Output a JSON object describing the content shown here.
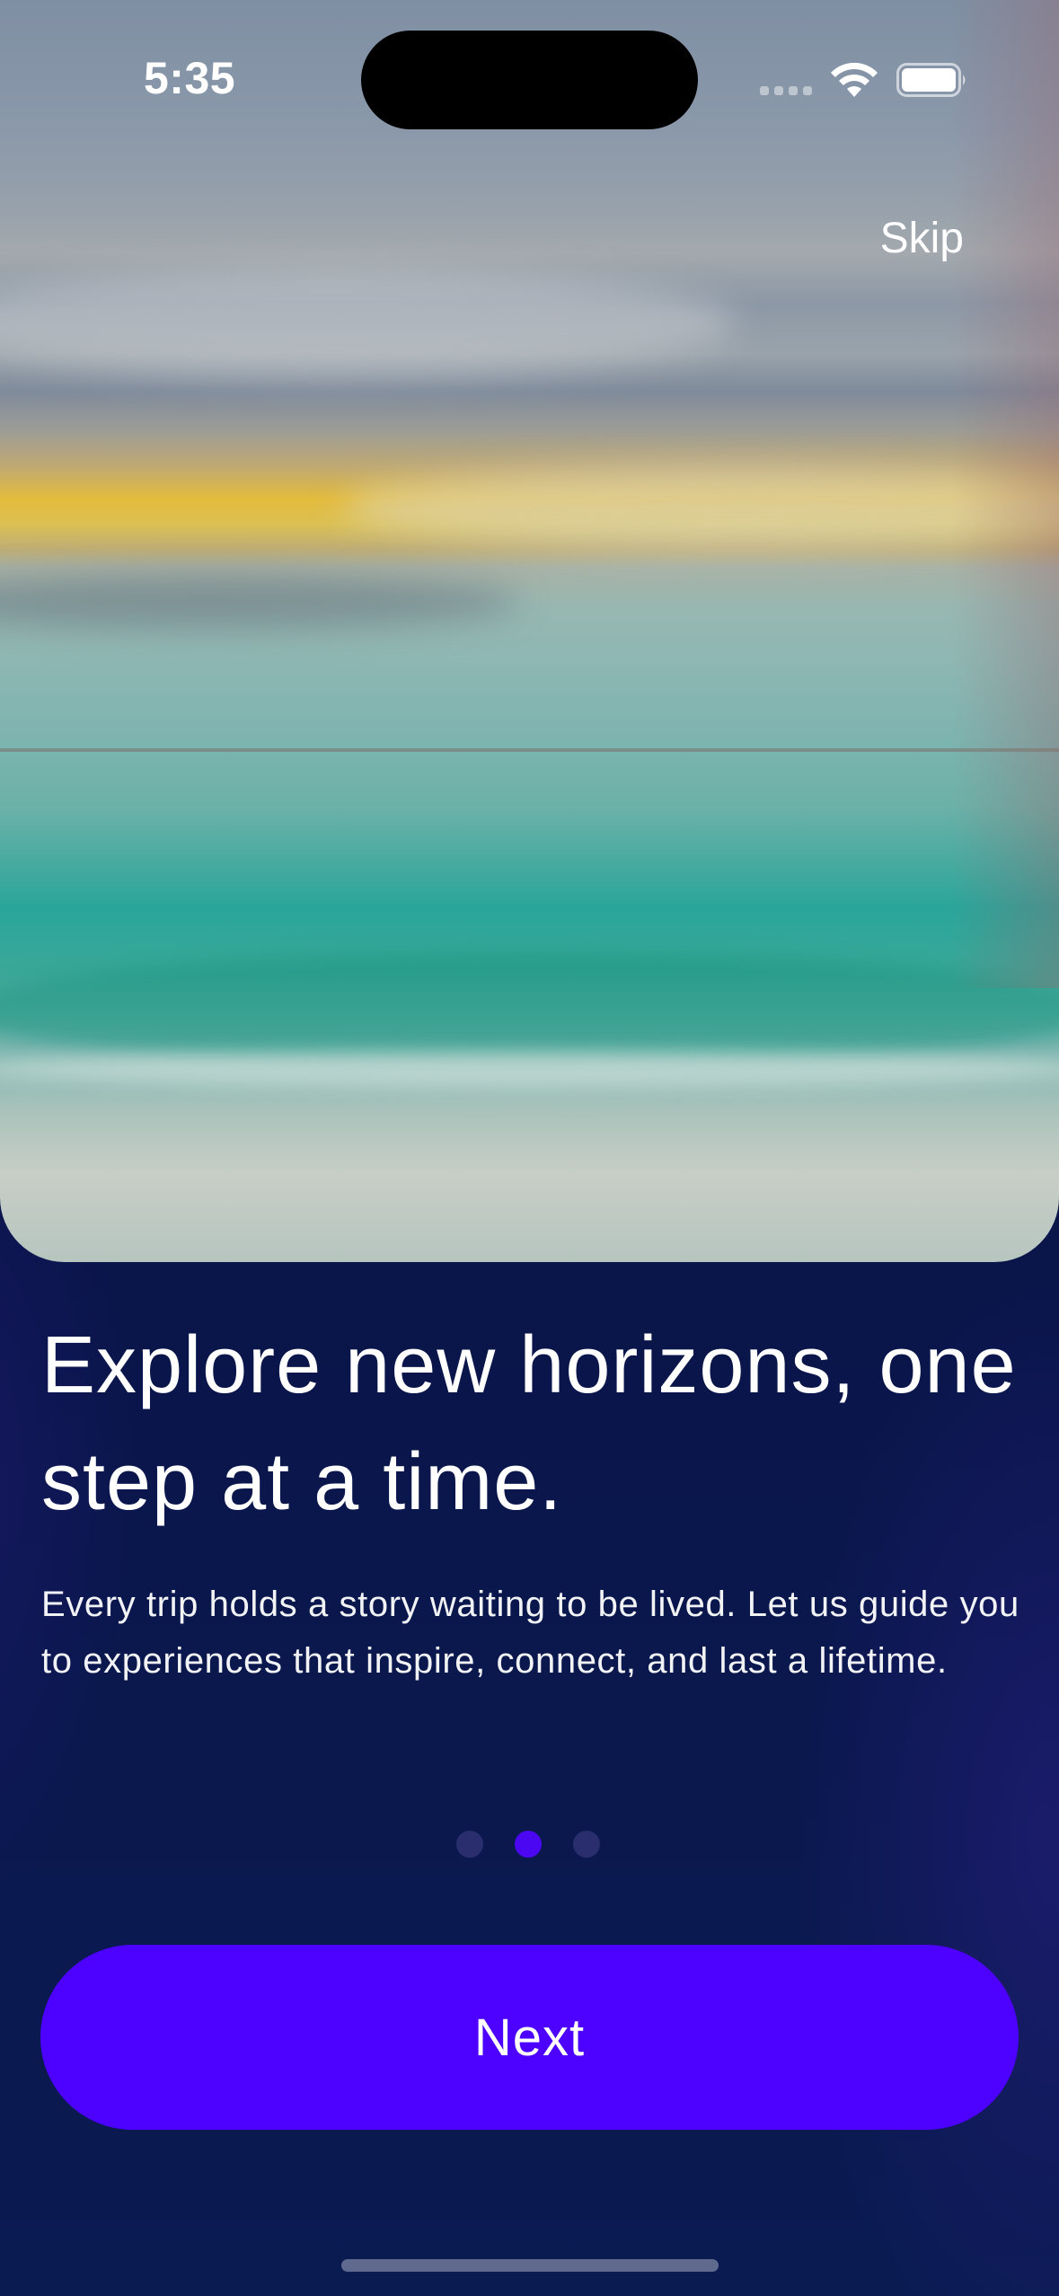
{
  "status_bar": {
    "time": "5:35",
    "icons": [
      "signal-icon",
      "wifi-icon",
      "battery-icon"
    ]
  },
  "onboarding": {
    "skip_label": "Skip",
    "headline": "Explore new horizons, one step at a time.",
    "description": "Every trip holds a story waiting to be lived. Let us guide you to experiences that inspire, connect, and last a lifetime.",
    "page_indicator": {
      "total_pages": 3,
      "current_page": 2
    },
    "next_label": "Next"
  },
  "colors": {
    "background": "#0b1448",
    "accent": "#4d02ff",
    "dot_inactive": "#2a2e6e",
    "dot_active": "#4b07f2"
  }
}
